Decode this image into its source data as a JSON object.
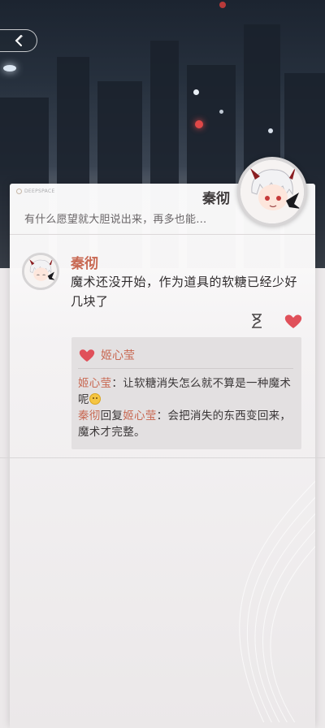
{
  "profile": {
    "name": "秦彻",
    "signature": "有什么愿望就大胆说出来，再多也能…",
    "logo_text": "DEEPSPACE"
  },
  "post": {
    "author": "秦彻",
    "text": "魔术还没开始，作为道具的软糖已经少好几块了"
  },
  "likes": {
    "names": "姬心莹"
  },
  "comments": [
    {
      "author": "姬心莹",
      "separator": "：",
      "text": "让软糖消失怎么就不算是一种魔术呢"
    },
    {
      "author": "秦彻",
      "reply_word": "回复",
      "reply_to": "姬心莹",
      "separator": "：",
      "text": "会把消失的东西变回来，魔术才完整。"
    }
  ],
  "icons": {
    "back": "back-arrow-icon",
    "timer": "hourglass-icon",
    "like": "heart-icon",
    "emoji": "smile-emoji-icon"
  },
  "colors": {
    "accent": "#c86852",
    "heart": "#e0505a"
  }
}
